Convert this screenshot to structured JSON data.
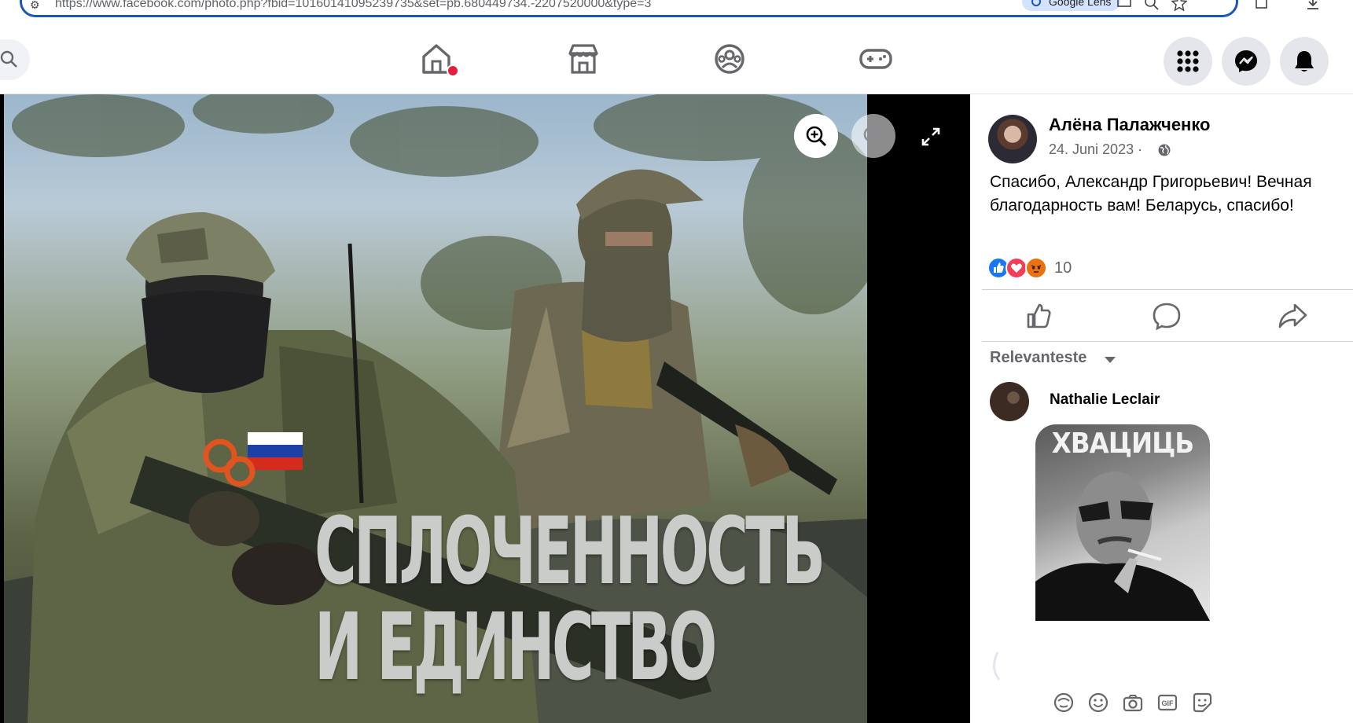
{
  "browser": {
    "url": "https://www.facebook.com/photo.php?fbid=10160141095239735&set=pb.680449734.-2207520000&type=3",
    "lens_label": "Google Lens"
  },
  "header": {
    "nav_icons": [
      "home-icon",
      "marketplace-icon",
      "groups-icon",
      "gaming-icon"
    ],
    "right_buttons": [
      "menu-grid-icon",
      "messenger-icon",
      "notifications-icon"
    ],
    "accent_color": "#1877f2",
    "notification_dot_color": "#e41e3f"
  },
  "photo": {
    "caption_line1": "СПЛОЧЕННОСТЬ",
    "caption_line2": "И ЕДИНСТВО",
    "controls": [
      "zoom-in-icon",
      "zoom-out-icon",
      "fullscreen-icon"
    ]
  },
  "post": {
    "author": "Алёна Палажченко",
    "date": "24. Juni 2023 ·",
    "text": "Спасибо, Александр Григорьевич! Вечная благодарность вам! Беларусь, спасибо!",
    "reaction_count": "10",
    "reactions": [
      "like",
      "love",
      "angry"
    ]
  },
  "comments": {
    "sort_label": "Relevanteste",
    "items": [
      {
        "name": "Nathalie Leclair",
        "sticker_text": "ХВАЦИЦЬ"
      }
    ]
  },
  "composer": {
    "tools": [
      "avatar-sticker-icon",
      "emoji-icon",
      "camera-icon",
      "gif-icon",
      "sticker-icon"
    ]
  }
}
